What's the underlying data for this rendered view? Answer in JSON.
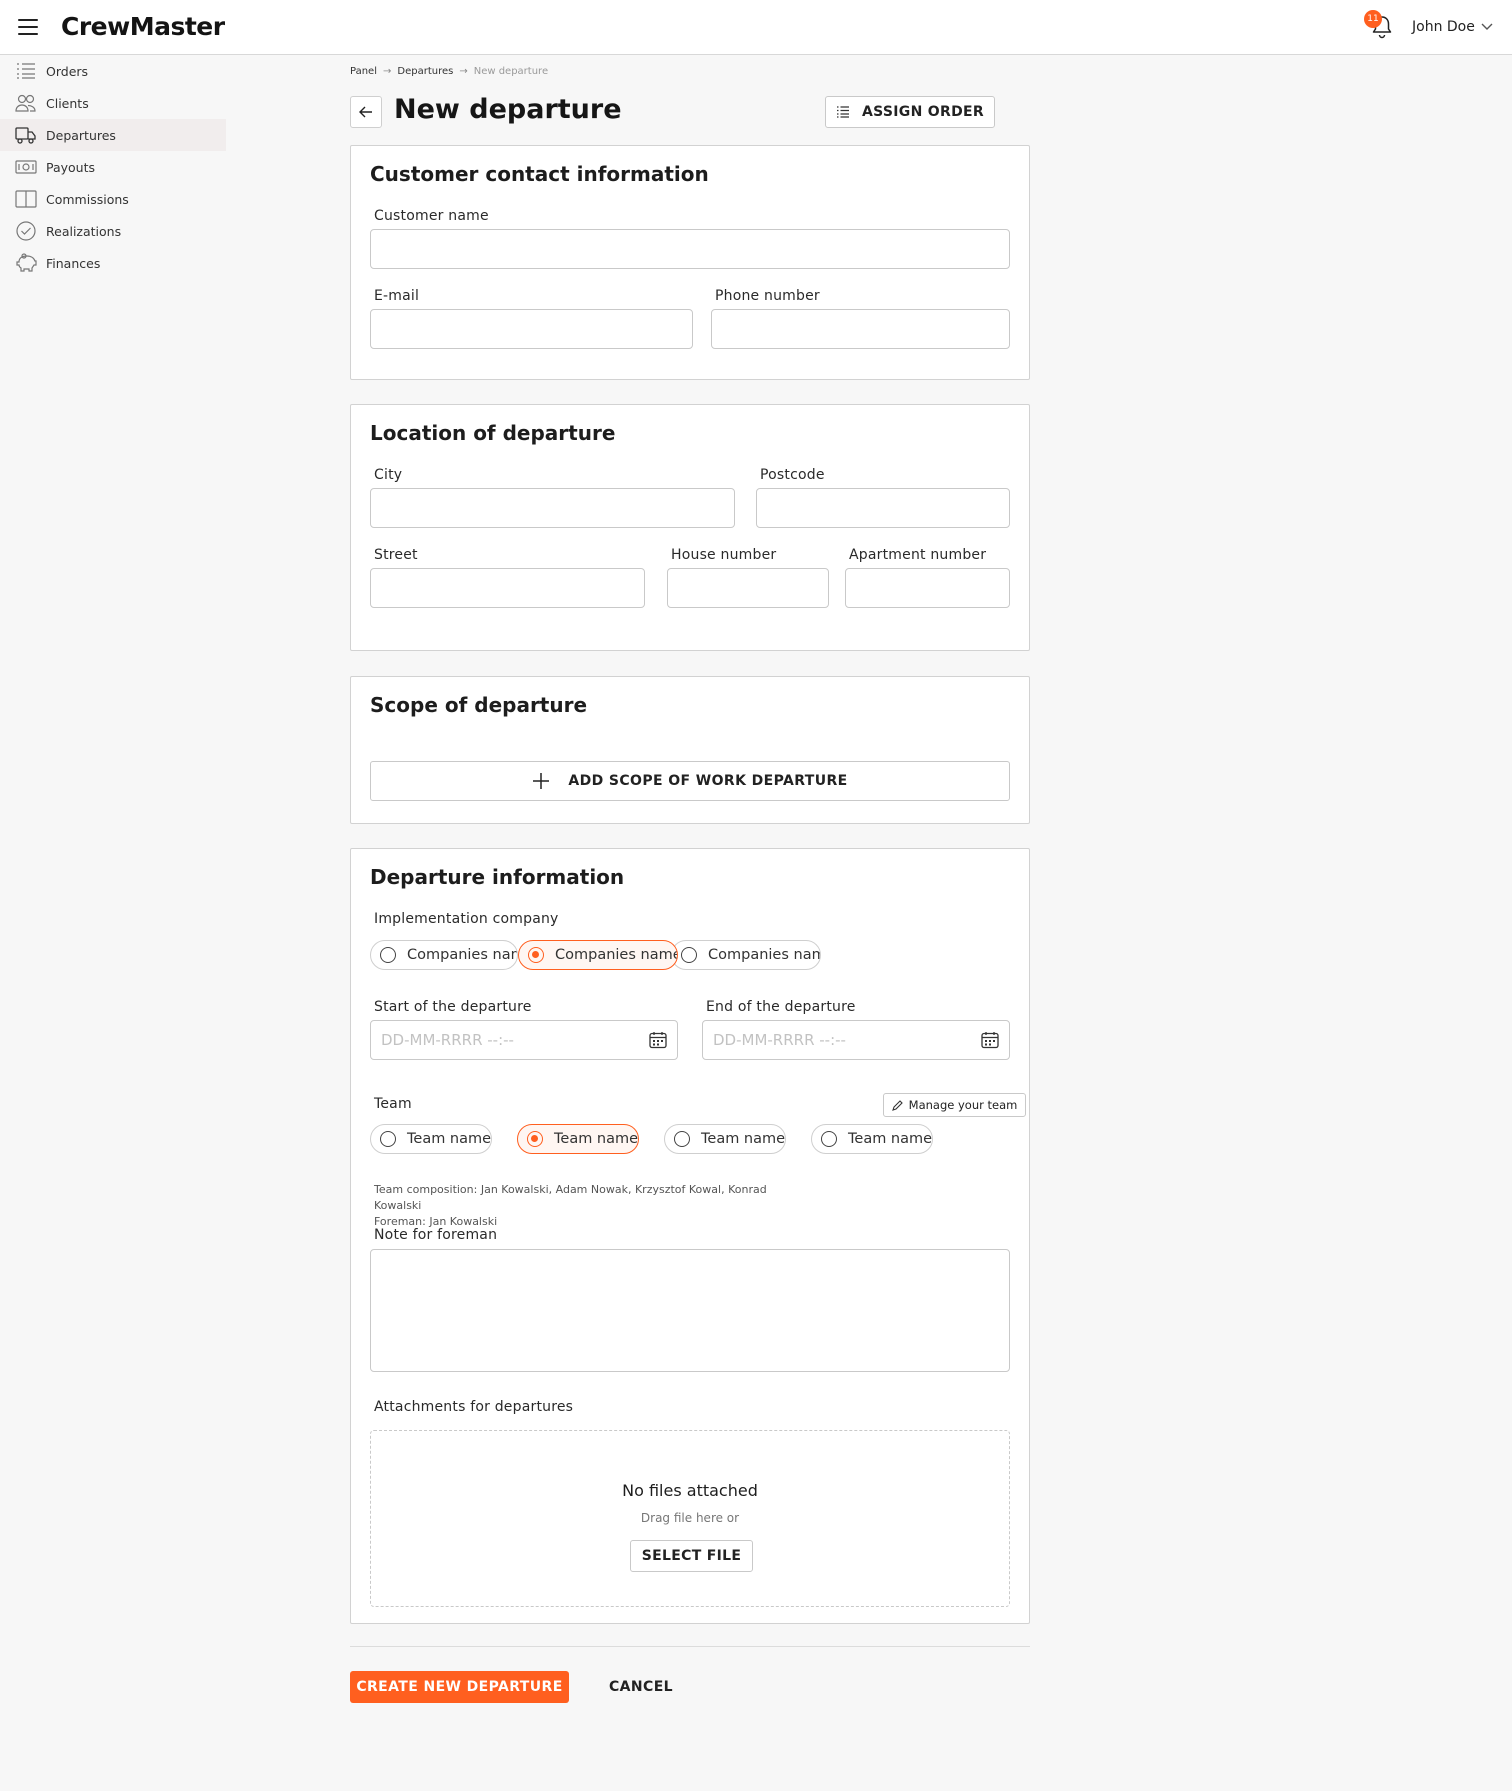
{
  "app": {
    "title": "CrewMaster",
    "notifications": "11",
    "user_name": "John Doe"
  },
  "sidebar": {
    "items": [
      {
        "label": "Orders",
        "icon": "list-icon"
      },
      {
        "label": "Clients",
        "icon": "users-icon"
      },
      {
        "label": "Departures",
        "icon": "truck-icon",
        "active": true
      },
      {
        "label": "Payouts",
        "icon": "money-icon"
      },
      {
        "label": "Commissions",
        "icon": "book-icon"
      },
      {
        "label": "Realizations",
        "icon": "check-circle-icon"
      },
      {
        "label": "Finances",
        "icon": "piggy-bank-icon"
      }
    ]
  },
  "breadcrumb": [
    "Panel",
    "Departures",
    "New departure"
  ],
  "page": {
    "title": "New departure",
    "assign_order_label": "ASSIGN ORDER"
  },
  "contact": {
    "title": "Customer contact information",
    "customer_name_label": "Customer name",
    "email_label": "E-mail",
    "phone_label": "Phone number"
  },
  "location": {
    "title": "Location of departure",
    "city_label": "City",
    "postcode_label": "Postcode",
    "street_label": "Street",
    "house_label": "House number",
    "apartment_label": "Apartment number"
  },
  "scope": {
    "title": "Scope of departure",
    "add_label": "ADD SCOPE OF WORK DEPARTURE"
  },
  "departure": {
    "title": "Departure information",
    "company_label": "Implementation company",
    "companies": [
      {
        "label": "Companies name",
        "selected": false
      },
      {
        "label": "Companies name",
        "selected": true
      },
      {
        "label": "Companies name",
        "selected": false
      }
    ],
    "start_label": "Start of the departure",
    "end_label": "End of the departure",
    "date_placeholder": "DD-MM-RRRR --:--",
    "team_label": "Team",
    "manage_team_label": "Manage your team",
    "teams": [
      {
        "label": "Team name",
        "selected": false
      },
      {
        "label": "Team name",
        "selected": true
      },
      {
        "label": "Team name",
        "selected": false
      },
      {
        "label": "Team name",
        "selected": false
      }
    ],
    "team_composition": "Team composition: Jan Kowalski, Adam Nowak, Krzysztof Kowal, Konrad Kowalski",
    "foreman": "Foreman: Jan Kowalski",
    "note_label": "Note for foreman",
    "attachments_label": "Attachments for departures",
    "no_files": "No files attached",
    "drag_hint": "Drag file here or",
    "select_file_label": "SELECT FILE"
  },
  "footer": {
    "create_label": "CREATE NEW DEPARTURE",
    "cancel_label": "CANCEL"
  },
  "colors": {
    "accent": "#ff5f1f",
    "background": "#f7f7f7",
    "border": "#c9c9c9"
  }
}
